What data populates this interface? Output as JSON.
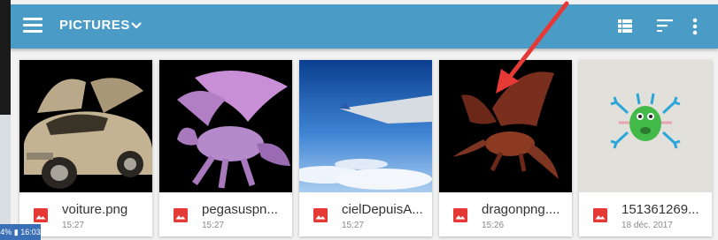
{
  "toolbar": {
    "title": "PICTURES",
    "background": "#4a9cc7",
    "icons": [
      "menu-icon",
      "chevron-down-icon",
      "list-view-icon",
      "sort-icon",
      "more-vert-icon"
    ]
  },
  "status_bar": {
    "text": "4% ▮ 16:03"
  },
  "files": [
    {
      "name": "voiture.png",
      "date": "15:27"
    },
    {
      "name": "pegasuspn...",
      "date": "15:27"
    },
    {
      "name": "cielDepuisA...",
      "date": "15:27"
    },
    {
      "name": "dragonpng....",
      "date": "15:26"
    },
    {
      "name": "151361269...",
      "date": "18 déc. 2017"
    }
  ],
  "colors": {
    "accent": "#4a9cc7",
    "file_icon": "#e53935",
    "annotation_arrow": "#e53935"
  }
}
